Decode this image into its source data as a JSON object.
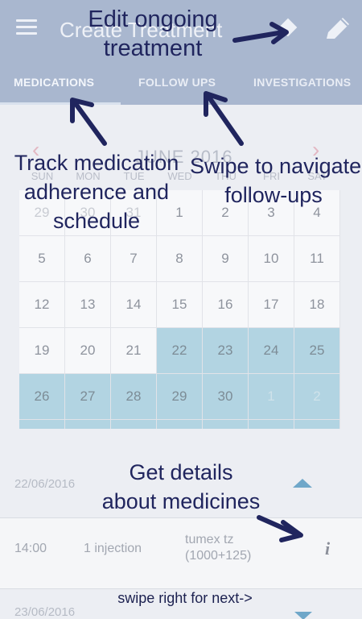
{
  "app": {
    "title": "Create Treatment"
  },
  "tabs": [
    {
      "label": "MEDICATIONS"
    },
    {
      "label": "FOLLOW UPS"
    },
    {
      "label": "INVESTIGATIONS"
    }
  ],
  "calendar": {
    "month_label": "JUNE 2016",
    "prev_symbol": "‹",
    "next_symbol": "›",
    "weekdays": [
      "SUN",
      "MON",
      "TUE",
      "WED",
      "THU",
      "FRI",
      "SAT"
    ],
    "weeks": [
      [
        {
          "d": "29",
          "muted": true
        },
        {
          "d": "30",
          "muted": true
        },
        {
          "d": "31",
          "muted": true
        },
        {
          "d": "1"
        },
        {
          "d": "2"
        },
        {
          "d": "3"
        },
        {
          "d": "4"
        }
      ],
      [
        {
          "d": "5"
        },
        {
          "d": "6"
        },
        {
          "d": "7"
        },
        {
          "d": "8"
        },
        {
          "d": "9"
        },
        {
          "d": "10"
        },
        {
          "d": "11"
        }
      ],
      [
        {
          "d": "12"
        },
        {
          "d": "13"
        },
        {
          "d": "14"
        },
        {
          "d": "15"
        },
        {
          "d": "16"
        },
        {
          "d": "17"
        },
        {
          "d": "18"
        }
      ],
      [
        {
          "d": "19"
        },
        {
          "d": "20"
        },
        {
          "d": "21"
        },
        {
          "d": "22",
          "sel": true
        },
        {
          "d": "23",
          "sel": true
        },
        {
          "d": "24",
          "sel": true
        },
        {
          "d": "25",
          "sel": true
        }
      ],
      [
        {
          "d": "26",
          "sel": true
        },
        {
          "d": "27",
          "sel": true
        },
        {
          "d": "28",
          "sel": true
        },
        {
          "d": "29",
          "sel": true
        },
        {
          "d": "30",
          "sel": true
        },
        {
          "d": "1",
          "sel": true,
          "muted": true
        },
        {
          "d": "2",
          "sel": true,
          "muted": true
        }
      ],
      [
        {
          "d": "",
          "sel": true
        },
        {
          "d": "",
          "sel": true
        },
        {
          "d": "",
          "sel": true
        },
        {
          "d": "",
          "sel": true
        },
        {
          "d": "",
          "sel": true
        },
        {
          "d": "",
          "sel": true
        },
        {
          "d": "",
          "sel": true
        }
      ]
    ]
  },
  "schedule": {
    "day1": "22/06/2016",
    "day2": "23/06/2016",
    "dose": {
      "time": "14:00",
      "quantity": "1 injection",
      "medicine_line1": "tumex tz",
      "medicine_line2": "(1000+125)"
    }
  },
  "overlay": {
    "edit_tip": [
      "Edit ongoing",
      "treatment"
    ],
    "track_tip": [
      "Track medication",
      "adherence and",
      "schedule"
    ],
    "swipe_tip": [
      "Swipe to navigate",
      "follow-ups"
    ],
    "details_tip": [
      "Get details",
      "about medicines"
    ],
    "next_tip": "swipe right for next->"
  },
  "colors": {
    "appbar": "#a9b7cf",
    "selected_day": "#b2d4e2",
    "overlay_text": "#20255e",
    "chevron": "#6fa7c9"
  },
  "icons": [
    "menu-icon",
    "diamond-icon",
    "pencil-icon",
    "chevron-up-icon",
    "chevron-down-icon",
    "info-icon"
  ]
}
